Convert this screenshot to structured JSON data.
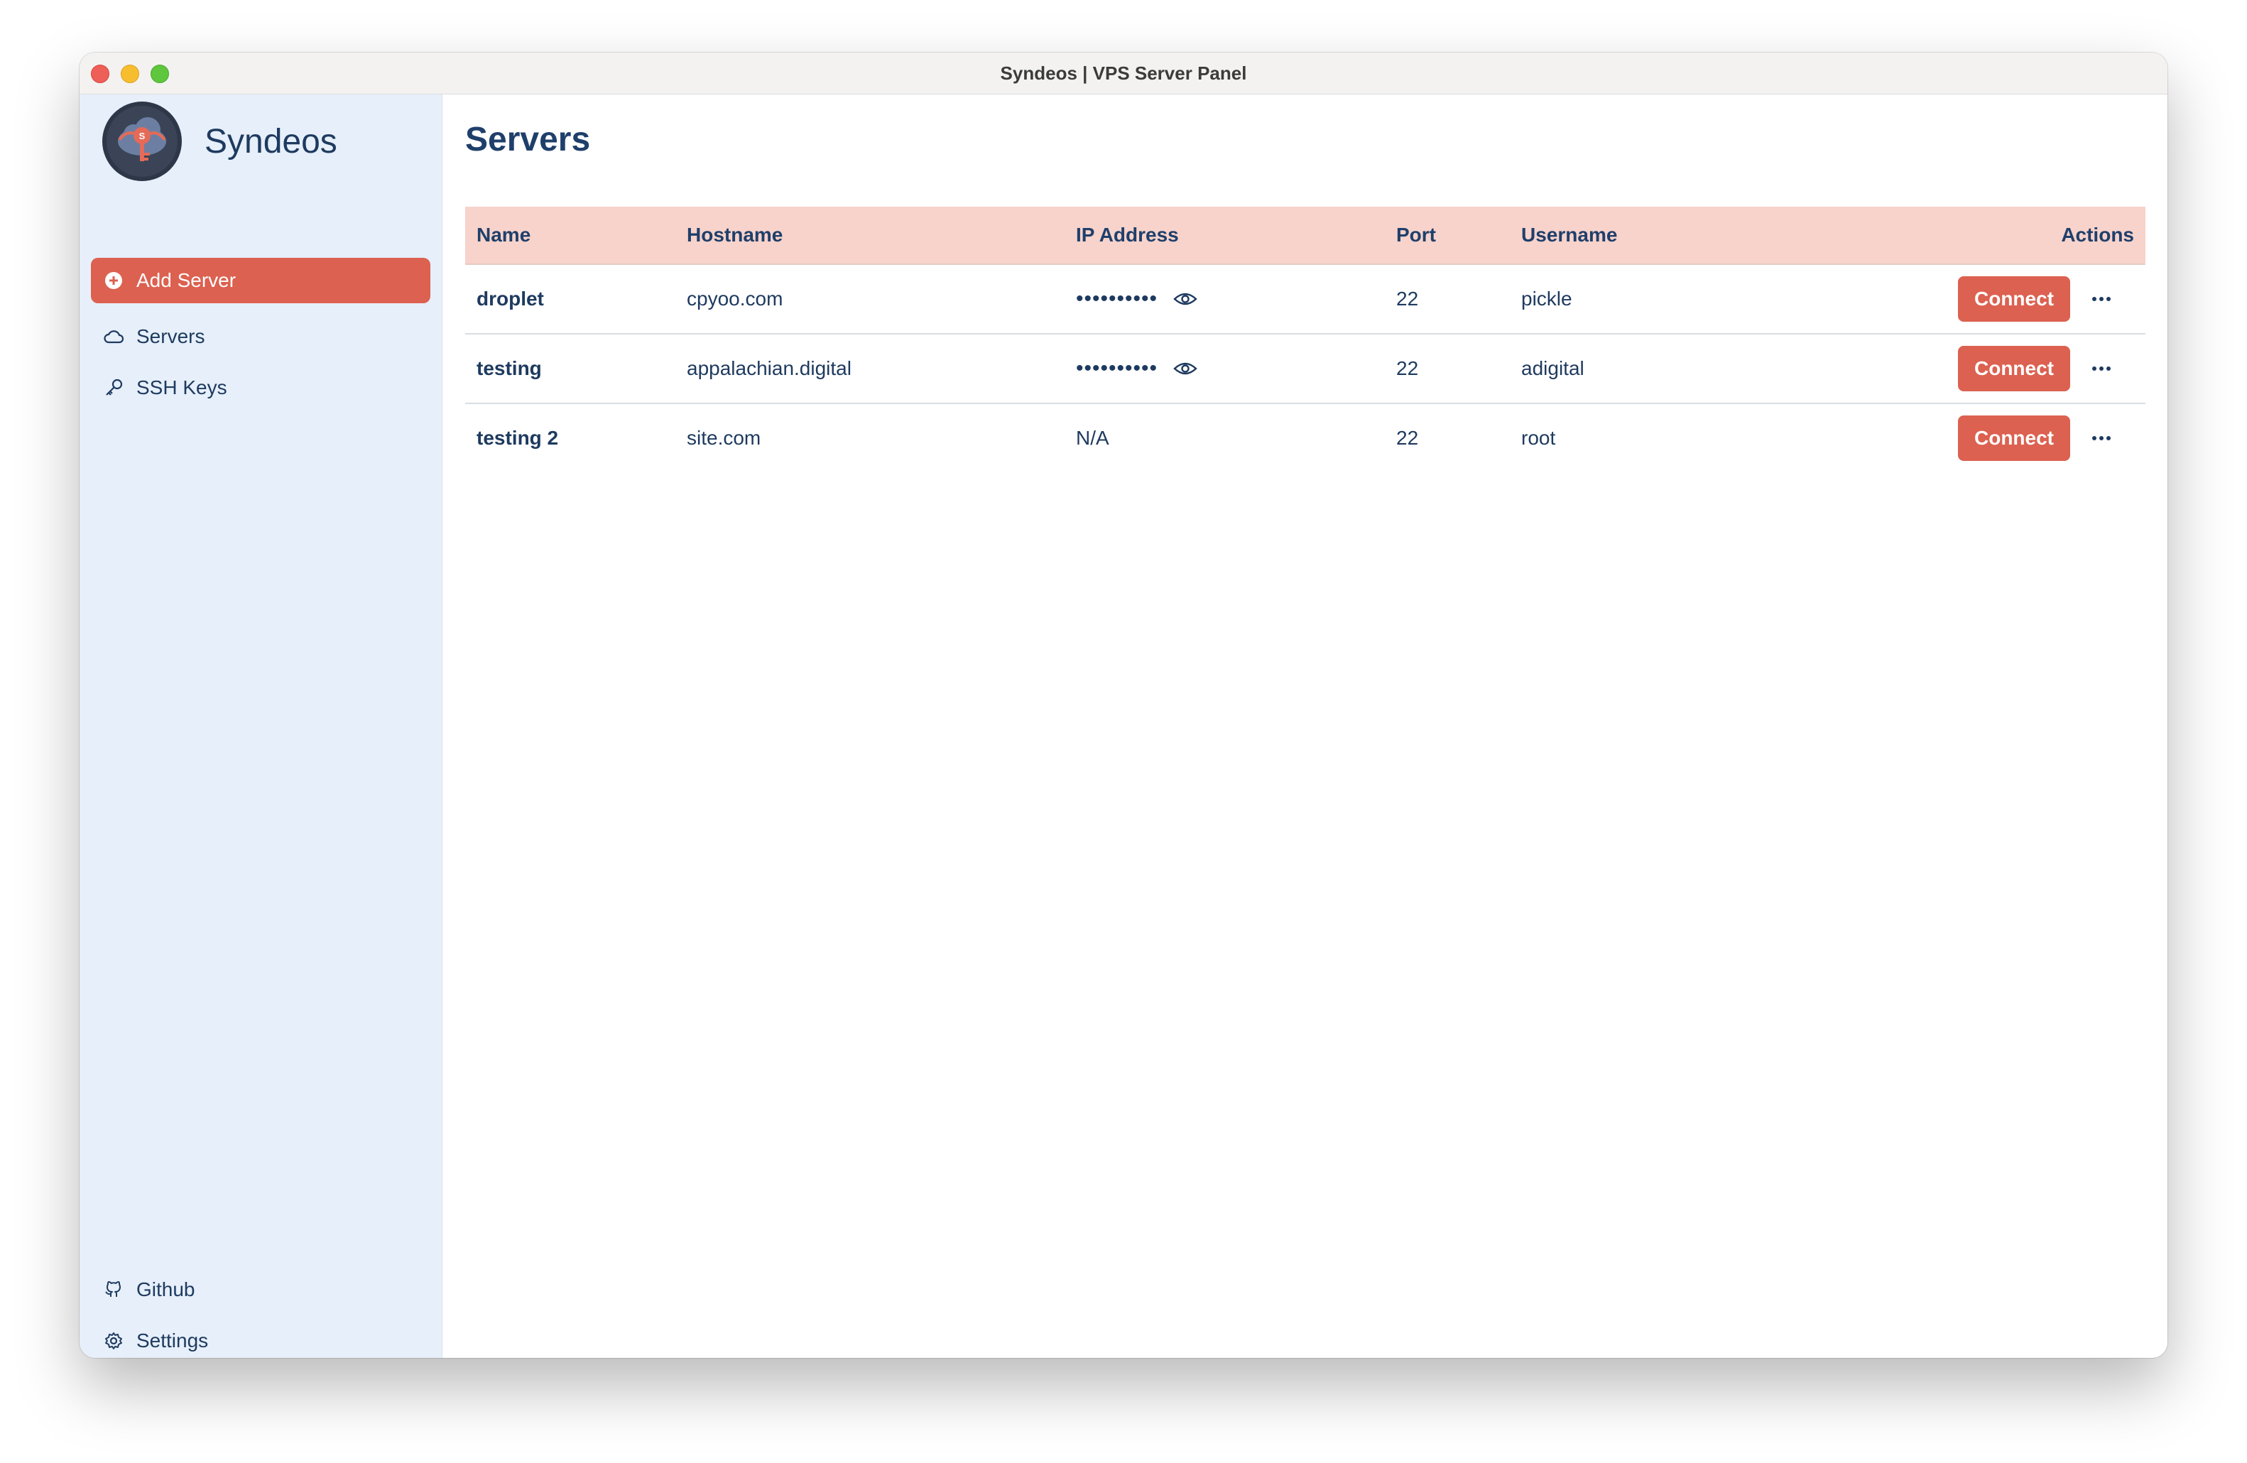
{
  "window": {
    "title": "Syndeos | VPS Server Panel"
  },
  "sidebar": {
    "brand": "Syndeos",
    "add_button": "Add Server",
    "items": [
      {
        "label": "Servers",
        "icon": "cloud-icon"
      },
      {
        "label": "SSH Keys",
        "icon": "key-icon"
      }
    ],
    "footer_items": [
      {
        "label": "Github",
        "icon": "github-icon"
      },
      {
        "label": "Settings",
        "icon": "gear-icon"
      }
    ]
  },
  "main": {
    "title": "Servers",
    "columns": [
      "Name",
      "Hostname",
      "IP Address",
      "Port",
      "Username",
      "Actions"
    ],
    "rows": [
      {
        "name": "droplet",
        "hostname": "cpyoo.com",
        "ip": "••••••••••",
        "port": "22",
        "username": "pickle",
        "action": "Connect"
      },
      {
        "name": "testing",
        "hostname": "appalachian.digital",
        "ip": "••••••••••",
        "port": "22",
        "username": "adigital",
        "action": "Connect"
      },
      {
        "name": "testing 2",
        "hostname": "site.com",
        "ip": "N/A",
        "port": "22",
        "username": "root",
        "action": "Connect"
      }
    ]
  },
  "colors": {
    "accent": "#dc6150",
    "sidebar_bg": "#e6effa",
    "header_bg": "#f7d3cb",
    "text": "#1e3a5f"
  }
}
